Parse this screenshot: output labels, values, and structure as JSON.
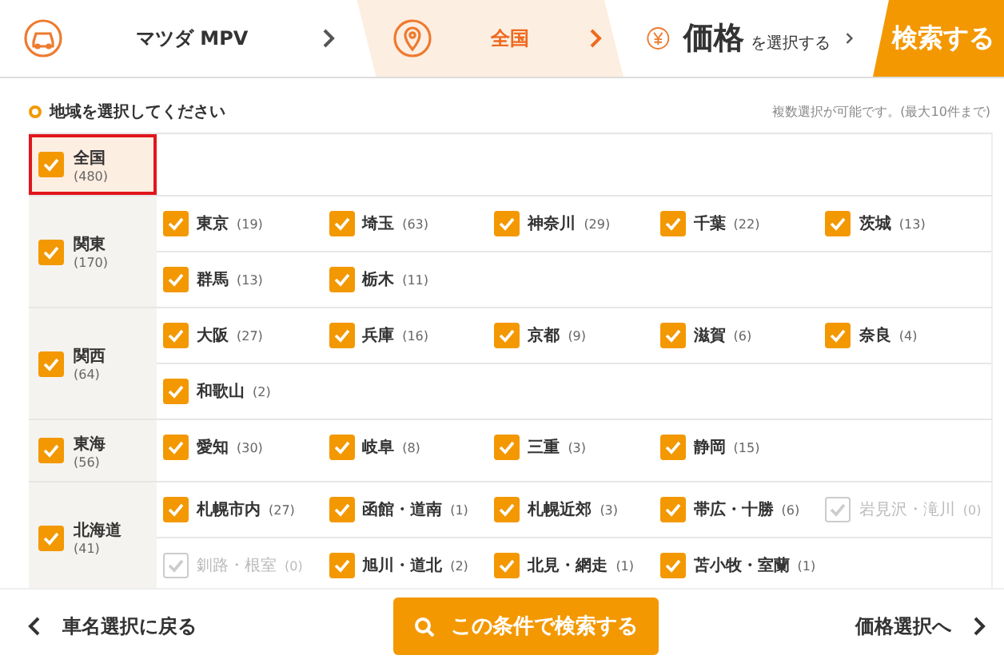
{
  "steps": [
    {
      "kind": "model",
      "label": "マツダ MPV",
      "selected": false
    },
    {
      "kind": "area",
      "label": "全国",
      "selected": true
    },
    {
      "kind": "price",
      "label": "価格",
      "suffix": "を選択する",
      "selected": false
    }
  ],
  "search_tab": "検索する",
  "section": {
    "title": "地域を選択してください",
    "note": "複数選択が可能です。(最大10件まで)"
  },
  "regions": [
    {
      "name": "全国",
      "count": "(480)",
      "checked": true,
      "selected": true
    },
    {
      "name": "関東",
      "count": "(170)",
      "checked": true,
      "selected": false,
      "prefectures": [
        {
          "name": "東京",
          "count": "(19)",
          "checked": true,
          "disabled": false
        },
        {
          "name": "埼玉",
          "count": "(63)",
          "checked": true,
          "disabled": false
        },
        {
          "name": "神奈川",
          "count": "(29)",
          "checked": true,
          "disabled": false
        },
        {
          "name": "千葉",
          "count": "(22)",
          "checked": true,
          "disabled": false
        },
        {
          "name": "茨城",
          "count": "(13)",
          "checked": true,
          "disabled": false
        },
        {
          "name": "群馬",
          "count": "(13)",
          "checked": true,
          "disabled": false
        },
        {
          "name": "栃木",
          "count": "(11)",
          "checked": true,
          "disabled": false
        }
      ]
    },
    {
      "name": "関西",
      "count": "(64)",
      "checked": true,
      "selected": false,
      "prefectures": [
        {
          "name": "大阪",
          "count": "(27)",
          "checked": true,
          "disabled": false
        },
        {
          "name": "兵庫",
          "count": "(16)",
          "checked": true,
          "disabled": false
        },
        {
          "name": "京都",
          "count": "(9)",
          "checked": true,
          "disabled": false
        },
        {
          "name": "滋賀",
          "count": "(6)",
          "checked": true,
          "disabled": false
        },
        {
          "name": "奈良",
          "count": "(4)",
          "checked": true,
          "disabled": false
        },
        {
          "name": "和歌山",
          "count": "(2)",
          "checked": true,
          "disabled": false
        }
      ]
    },
    {
      "name": "東海",
      "count": "(56)",
      "checked": true,
      "selected": false,
      "prefectures": [
        {
          "name": "愛知",
          "count": "(30)",
          "checked": true,
          "disabled": false
        },
        {
          "name": "岐阜",
          "count": "(8)",
          "checked": true,
          "disabled": false
        },
        {
          "name": "三重",
          "count": "(3)",
          "checked": true,
          "disabled": false
        },
        {
          "name": "静岡",
          "count": "(15)",
          "checked": true,
          "disabled": false
        }
      ]
    },
    {
      "name": "北海道",
      "count": "(41)",
      "checked": true,
      "selected": false,
      "prefectures": [
        {
          "name": "札幌市内",
          "count": "(27)",
          "checked": true,
          "disabled": false
        },
        {
          "name": "函館・道南",
          "count": "(1)",
          "checked": true,
          "disabled": false
        },
        {
          "name": "札幌近郊",
          "count": "(3)",
          "checked": true,
          "disabled": false
        },
        {
          "name": "帯広・十勝",
          "count": "(6)",
          "checked": true,
          "disabled": false
        },
        {
          "name": "岩見沢・滝川",
          "count": "(0)",
          "checked": false,
          "disabled": true
        },
        {
          "name": "釧路・根室",
          "count": "(0)",
          "checked": false,
          "disabled": true
        },
        {
          "name": "旭川・道北",
          "count": "(2)",
          "checked": true,
          "disabled": false
        },
        {
          "name": "北見・網走",
          "count": "(1)",
          "checked": true,
          "disabled": false
        },
        {
          "name": "苫小牧・室蘭",
          "count": "(1)",
          "checked": true,
          "disabled": false
        }
      ]
    }
  ],
  "footer": {
    "back": "車名選択に戻る",
    "submit": "この条件で検索する",
    "next": "価格選択へ"
  }
}
